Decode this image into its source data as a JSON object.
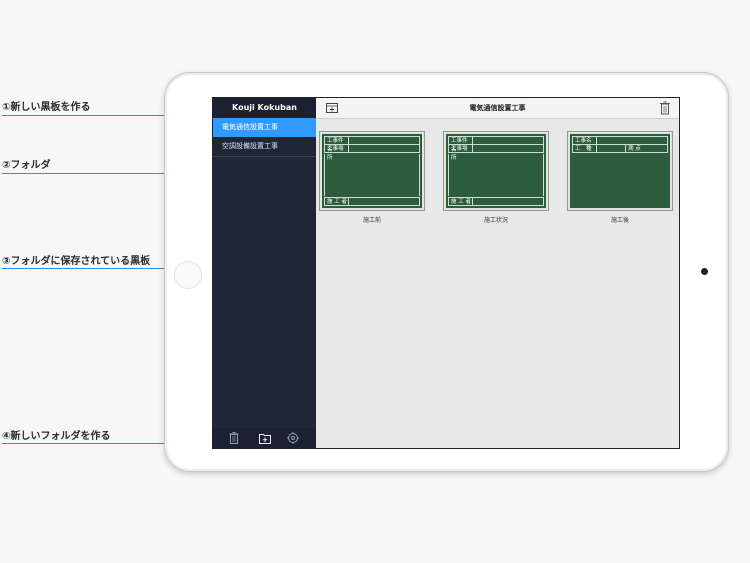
{
  "annotations": {
    "a1": "①新しい黒板を作る",
    "a2": "②フォルダ",
    "a3": "③フォルダに保存されている黒板",
    "a4": "④新しいフォルダを作る"
  },
  "sidebar": {
    "title": "Kouji Kokuban",
    "folders": [
      "電気通信設置工事",
      "空調設備設置工事"
    ],
    "active_folder_index": 0
  },
  "navbar": {
    "title": "電気通信設置工事",
    "new_board_icon": "new-board-icon",
    "trash_icon": "trash-icon"
  },
  "footer": {
    "trash_icon": "trash-icon",
    "new_folder_icon": "new-folder-icon",
    "settings_icon": "gear-icon"
  },
  "boards": [
    {
      "caption": "施工前",
      "row1": "工事件名",
      "row2": "工事場所",
      "row2_right": "",
      "bottom": "施 工 者"
    },
    {
      "caption": "施工状況",
      "row1": "工事件名",
      "row2": "工事場所",
      "row2_right": "",
      "bottom": "施 工 者"
    },
    {
      "caption": "施工後",
      "row1": "工事名",
      "row2": "工　種",
      "row2_right": "測 点",
      "bottom": ""
    }
  ],
  "colors": {
    "accent": "#2f9bff",
    "sidebar": "#1f2636",
    "chalkboard": "#2d5b3d",
    "annotation_line": "#2f8fe6"
  }
}
